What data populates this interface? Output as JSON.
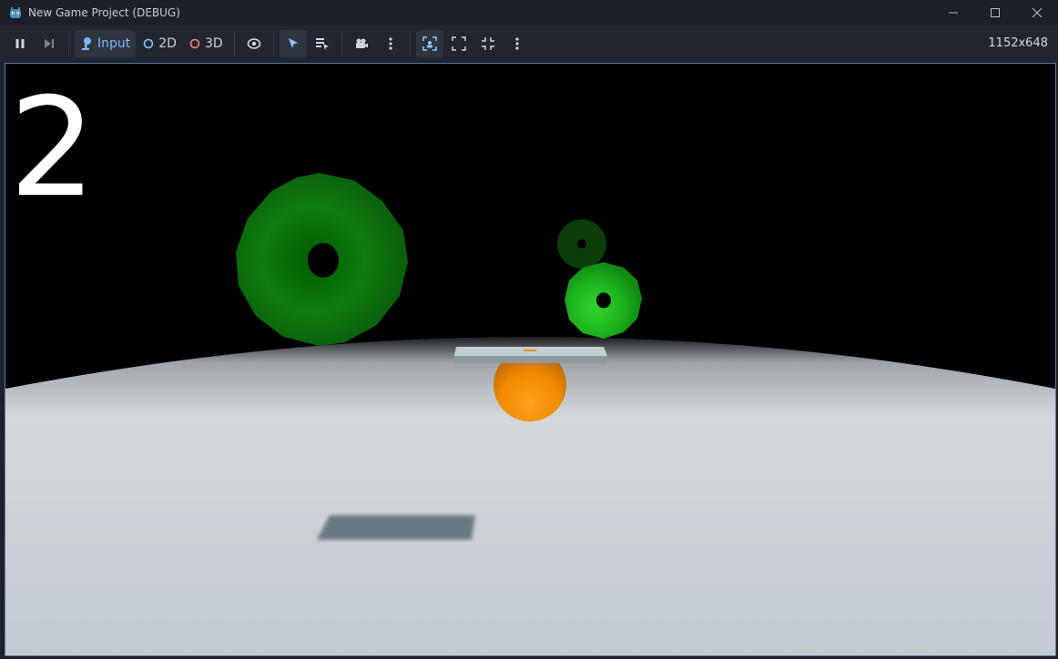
{
  "window": {
    "title": "New Game Project (DEBUG)",
    "controls": [
      "minimize-icon",
      "maximize-icon",
      "close-icon"
    ]
  },
  "toolbar": {
    "input_label": "Input",
    "mode_2d_label": "2D",
    "mode_3d_label": "3D",
    "resolution": "1152x648",
    "icons": [
      "pause-icon",
      "step-icon",
      "joystick-icon",
      "visibility-icon",
      "select-cursor-icon",
      "list-select-icon",
      "camera-icon",
      "more-options-icon",
      "camera-focus-icon",
      "expand-icon",
      "fullscreen-icon",
      "more-options-icon"
    ],
    "colors": {
      "accent": "#7fb7ff",
      "mode_2d": "#8fc7ff",
      "mode_3d": "#ff7f86"
    }
  },
  "game": {
    "score": "2",
    "colors": {
      "ring": "#0e8a0e",
      "ball": "#f08a00",
      "floor": "#c9d2d8",
      "paddle": "#c2ccd0"
    }
  }
}
